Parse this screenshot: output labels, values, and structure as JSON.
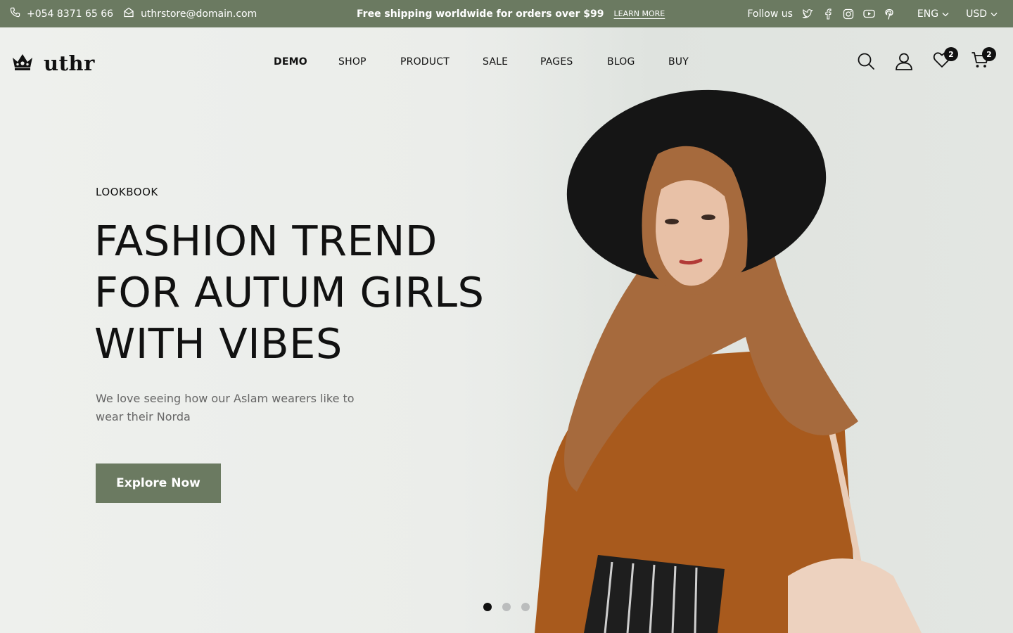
{
  "topbar": {
    "phone": "+054 8371 65 66",
    "email": "uthrstore@domain.com",
    "promo": "Free shipping worldwide for orders over $99",
    "learn_more": "LEARN MORE",
    "follow_label": "Follow us",
    "social_icons": [
      "twitter-icon",
      "facebook-icon",
      "instagram-icon",
      "youtube-icon",
      "pinterest-icon"
    ],
    "language": "ENG",
    "currency": "USD"
  },
  "header": {
    "logo_text": "uthr",
    "nav": [
      {
        "label": "DEMO",
        "active": true
      },
      {
        "label": "SHOP",
        "active": false
      },
      {
        "label": "PRODUCT",
        "active": false
      },
      {
        "label": "SALE",
        "active": false
      },
      {
        "label": "PAGES",
        "active": false
      },
      {
        "label": "BLOG",
        "active": false
      },
      {
        "label": "BUY",
        "active": false
      }
    ],
    "wishlist_count": "2",
    "cart_count": "2"
  },
  "hero": {
    "eyebrow": "LOOKBOOK",
    "headline_lines": [
      "FASHION TREND",
      "FOR AUTUM GIRLS",
      "WITH VIBES"
    ],
    "subtitle": "We love seeing how our Aslam wearers like to wear their Norda",
    "cta_label": "Explore Now",
    "slide_count": 3,
    "active_slide": 1
  },
  "colors": {
    "accent": "#6b7a61",
    "text": "#111111",
    "muted": "#666666",
    "background": "#eef0ed"
  }
}
